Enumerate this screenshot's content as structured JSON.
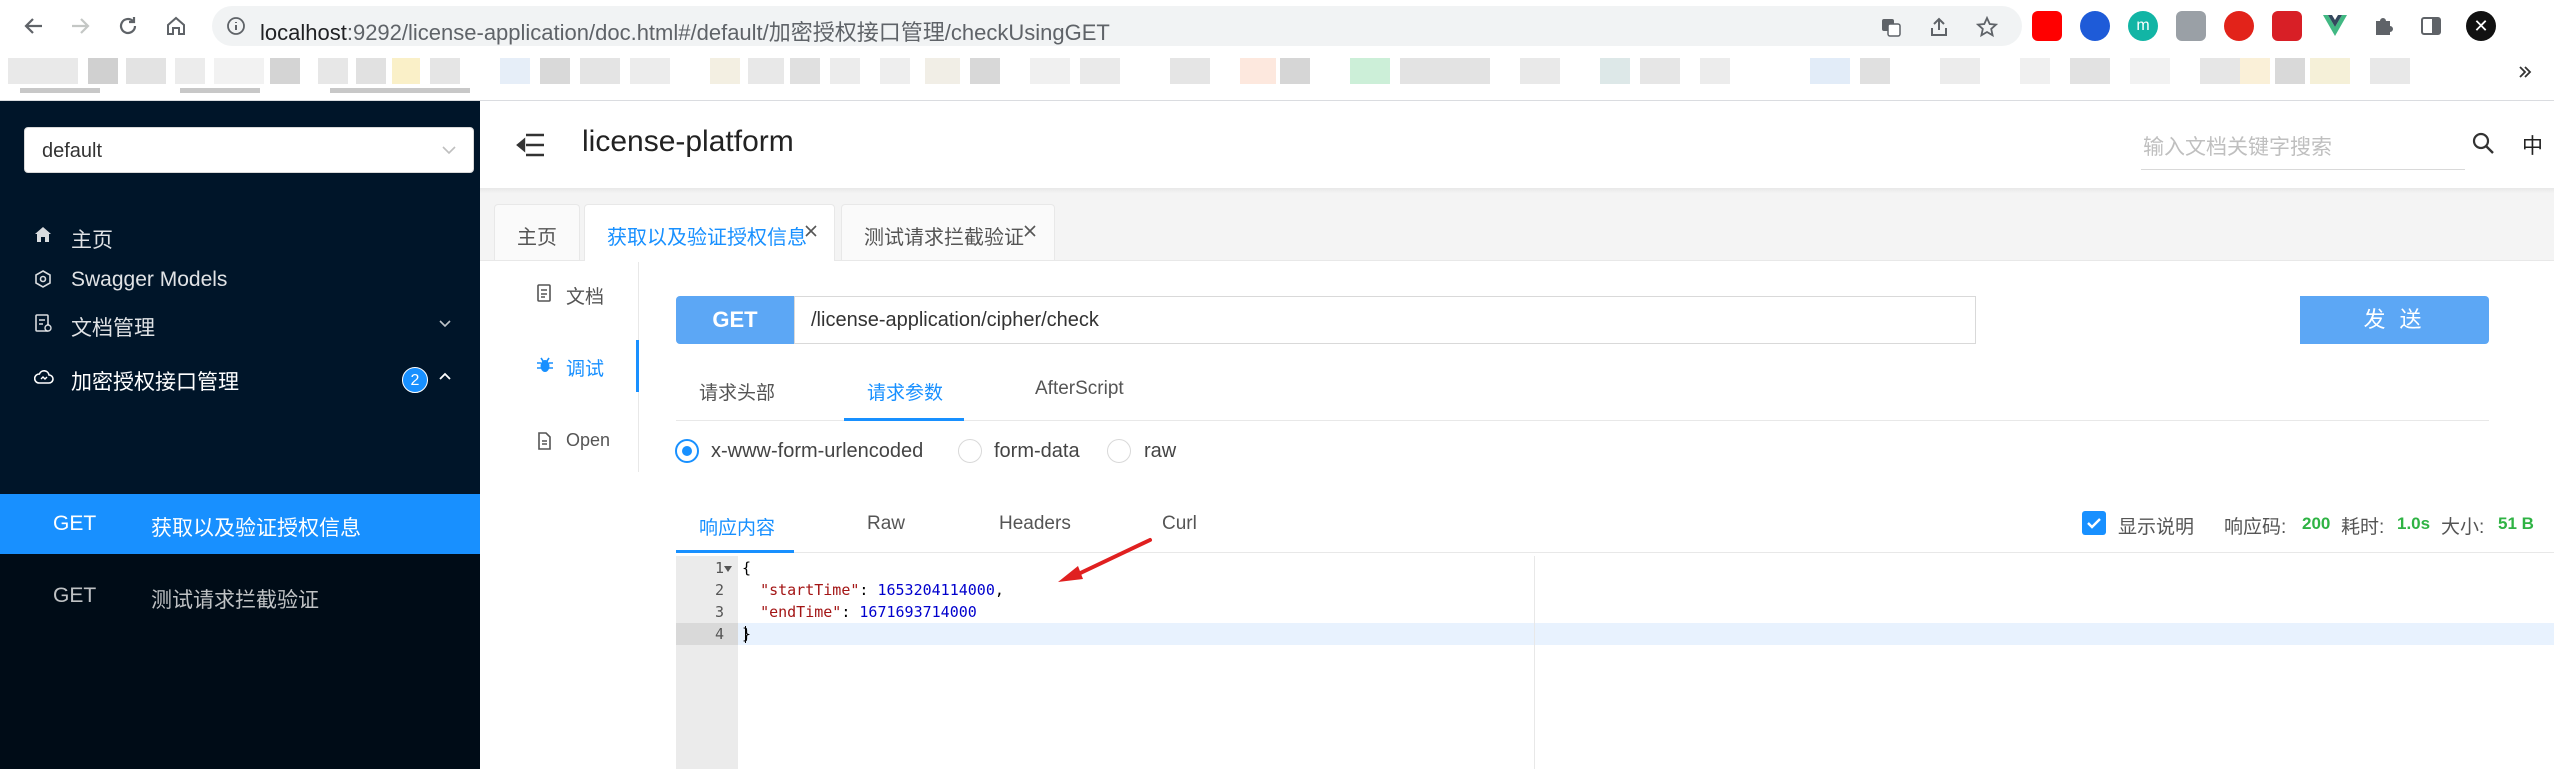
{
  "browser": {
    "url_host": "localhost",
    "url_rest": ":9292/license-application/doc.html#/default/加密授权接口管理/checkUsingGET"
  },
  "sidebar": {
    "group_select": "default",
    "menu": [
      {
        "label": "主页",
        "icon": "home-icon"
      },
      {
        "label": "Swagger Models",
        "icon": "models-icon"
      },
      {
        "label": "文档管理",
        "icon": "doc-manage-icon"
      },
      {
        "label": "加密授权接口管理",
        "icon": "cloud-icon",
        "badge": "2"
      }
    ],
    "submenu": [
      {
        "method": "GET",
        "name": "获取以及验证授权信息",
        "active": true
      },
      {
        "method": "GET",
        "name": "测试请求拦截验证",
        "active": false
      }
    ]
  },
  "header": {
    "title": "license-platform",
    "search_placeholder": "输入文档关键字搜索",
    "lang": "中"
  },
  "tabs": [
    {
      "label": "主页"
    },
    {
      "label": "获取以及验证授权信息",
      "active": true
    },
    {
      "label": "测试请求拦截验证"
    }
  ],
  "inner_nav": [
    {
      "label": "文档",
      "icon": "doc-icon"
    },
    {
      "label": "调试",
      "icon": "bug-icon",
      "active": true
    },
    {
      "label": "Open",
      "icon": "open-icon"
    }
  ],
  "request": {
    "method": "GET",
    "url": "/license-application/cipher/check",
    "send_label": "发 送",
    "tabs": [
      "请求头部",
      "请求参数",
      "AfterScript"
    ],
    "active_tab": "请求参数",
    "content_types": [
      "x-www-form-urlencoded",
      "form-data",
      "raw"
    ],
    "selected_content_type": "x-www-form-urlencoded"
  },
  "response": {
    "tabs": [
      "响应内容",
      "Raw",
      "Headers",
      "Curl"
    ],
    "active_tab": "响应内容",
    "show_desc_label": "显示说明",
    "status_label": "响应码:",
    "status_value": "200",
    "time_label": "耗时:",
    "time_value": "1.0s",
    "size_label": "大小:",
    "size_value": "51 B",
    "lines": [
      {
        "num": "1",
        "text": "{"
      },
      {
        "num": "2",
        "key": "\"startTime\"",
        "value": "1653204114000",
        "trail": ","
      },
      {
        "num": "3",
        "key": "\"endTime\"",
        "value": "1671693714000",
        "trail": ""
      },
      {
        "num": "4",
        "text": "}"
      }
    ]
  },
  "colors": {
    "accent": "#1890ff",
    "sidebar_bg": "#001529",
    "method_bg": "#5ca7f5",
    "success": "#2fb344",
    "arrow": "#e02020"
  }
}
